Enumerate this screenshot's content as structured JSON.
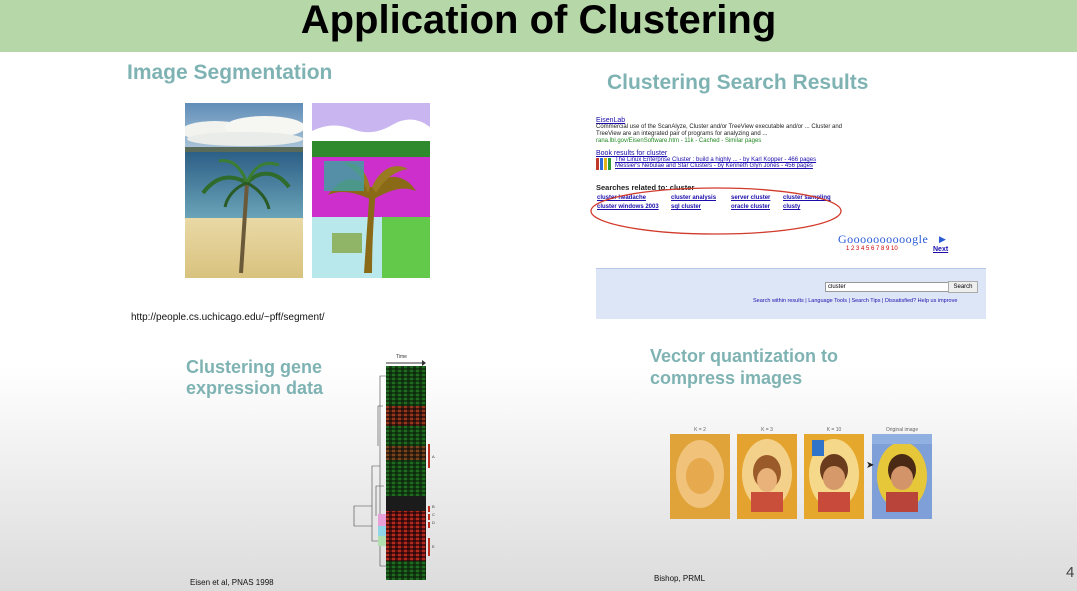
{
  "slide": {
    "title": "Application of Clustering",
    "page_number": "4"
  },
  "segmentation": {
    "heading": "Image Segmentation",
    "url": "http://people.cs.uchicago.edu/~pff/segment/"
  },
  "search_results": {
    "heading": "Clustering Search Results",
    "result_title": "EisenLab",
    "result_snippet_1": "Commercial use of the ScanAlyze, Cluster and/or TreeView executable and/or ... Cluster and",
    "result_snippet_2": "TreeView are an integrated pair of programs for analyzing and ...",
    "result_url": "rana.lbl.gov/EisenSoftware.htm - 11k - Cached - Similar pages",
    "book_results": "Book results for cluster",
    "book_1": "The Linux Enterprise Cluster : build a highly ... - by Karl Kopper - 466 pages",
    "book_2": "Messier's Nebulae and Star Clusters - by Kenneth Glyn Jones - 456 pages",
    "related_heading": "Searches related to: cluster",
    "related": [
      "cluster headache",
      "cluster analysis",
      "server cluster",
      "cluster sampling",
      "cluster windows 2003",
      "sql cluster",
      "oracle cluster",
      "clusty"
    ],
    "pager_logo": "Goooooooooogle",
    "pager_numbers": "1 2 3 4 5 6 7 8 9 10",
    "next_label": "Next",
    "search_value": "cluster",
    "search_button": "Search",
    "footer_links": "Search within results | Language Tools | Search Tips | Dissatisfied? Help us improve"
  },
  "gene": {
    "heading_line1": "Clustering gene",
    "heading_line2": "expression data",
    "heat_label": "Time",
    "citation": "Eisen et al, PNAS 1998",
    "side_labels": [
      "A",
      "B",
      "C",
      "D",
      "E"
    ]
  },
  "vq": {
    "heading_line1": "Vector quantization to",
    "heading_line2": "compress images",
    "labels": [
      "K = 2",
      "K = 3",
      "K = 10",
      "Original image"
    ],
    "citation": "Bishop, PRML"
  },
  "colors": {
    "title_bar": "#b6d7a8",
    "heading": "#7fb3b3",
    "circle": "#d23a2a"
  }
}
